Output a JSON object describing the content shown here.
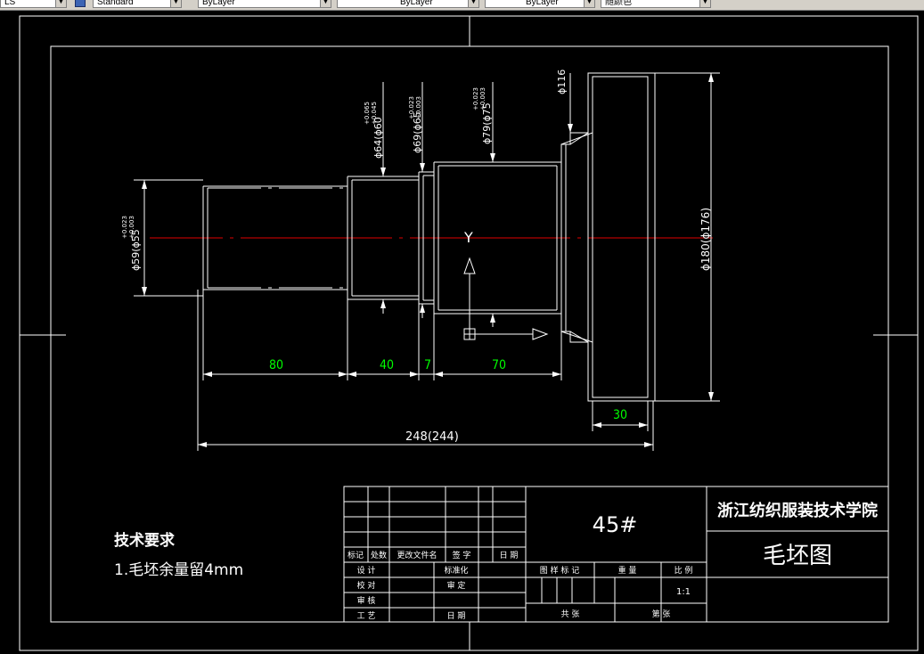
{
  "toolbar": {
    "combo1": "LS",
    "combo2": "Standard",
    "combo3": "ByLayer",
    "combo4": "ByLayer",
    "combo5": "ByLayer",
    "combo6": "随颜色"
  },
  "drawing": {
    "dims": {
      "d80": "80",
      "d40": "40",
      "d7": "7",
      "d70": "70",
      "d30": "30",
      "overall": "248(244)",
      "dia59": "ϕ59(ϕ55",
      "dia59_tol_up": "+0.023",
      "dia59_tol_low": "+0.003",
      "dia64": "ϕ64(ϕ60",
      "dia64_tol_up": "+0.065",
      "dia64_tol_low": "+0.045",
      "dia69": "ϕ69(ϕ65",
      "dia69_tol_up": "+0.023",
      "dia69_tol_low": "+0.003",
      "dia79": "ϕ79(ϕ75",
      "dia79_tol_up": "+0.023",
      "dia79_tol_low": "+0.003",
      "dia116": "ϕ116",
      "dia180": "ϕ180(ϕ176)"
    },
    "ucs_y": "Y"
  },
  "notes": {
    "heading": "技术要求",
    "line1": "1.毛坯余量留4mm"
  },
  "title_block": {
    "material": "45#",
    "school": "浙江纺织服装技术学院",
    "drawing_name": "毛坯图",
    "scale": "1:1",
    "rev_headers": [
      "标记",
      "处数",
      "更改文件名",
      "签  字",
      "日  期"
    ],
    "sign_rows": [
      {
        "label": "设  计",
        "label2": "标准化"
      },
      {
        "label": "校  对",
        "label2": "审  定"
      },
      {
        "label": "审  核",
        "label2": ""
      },
      {
        "label": "工  艺",
        "label2": "日  期"
      }
    ],
    "info_headers": [
      "图  样  标  记",
      "重  量",
      "比  例"
    ],
    "sheet_total": "共          张",
    "sheet_no": "第          张"
  }
}
